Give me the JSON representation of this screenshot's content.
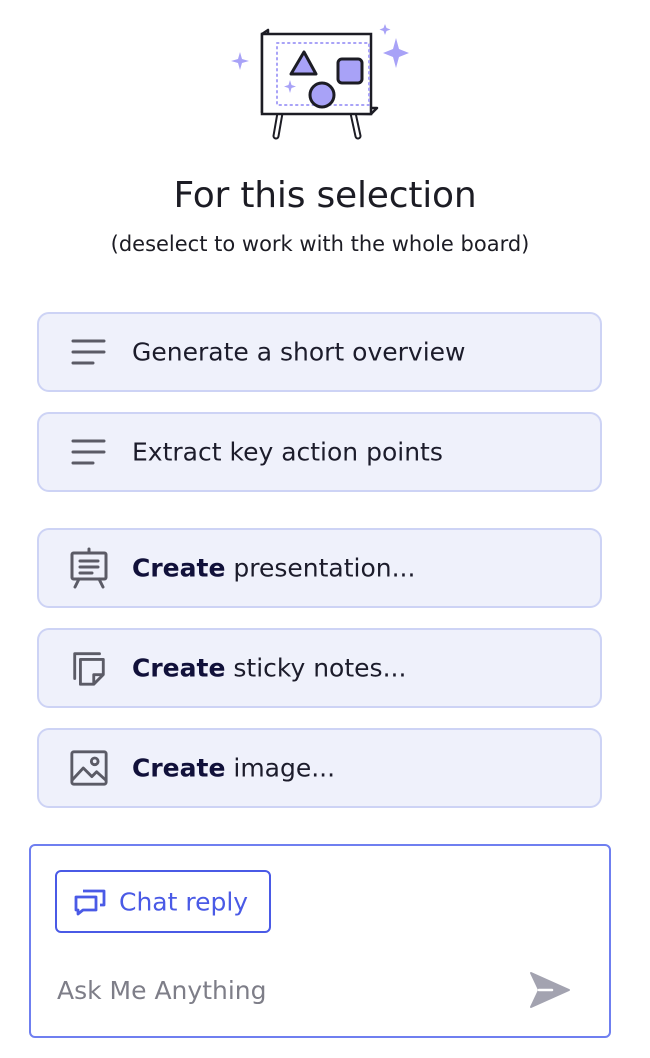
{
  "header": {
    "title": "For this selection",
    "subtitle": "(deselect to work with the whole board)"
  },
  "actions": [
    {
      "icon": "text-lines-icon",
      "bold": "",
      "label": "Generate a short overview"
    },
    {
      "icon": "text-lines-icon",
      "bold": "",
      "label": "Extract key action points"
    },
    {
      "icon": "presentation-easel-icon",
      "bold": "Create",
      "label": " presentation..."
    },
    {
      "icon": "sticky-notes-icon",
      "bold": "Create",
      "label": " sticky notes..."
    },
    {
      "icon": "image-icon",
      "bold": "Create",
      "label": " image..."
    }
  ],
  "composer": {
    "chip_label": "Chat reply",
    "chip_icon": "chat-bubbles-icon",
    "placeholder": "Ask Me Anything",
    "send_icon": "send-icon"
  },
  "colors": {
    "accent": "#4a5ae6",
    "button_bg": "#eff1fb",
    "button_border": "#cdd3f5",
    "illustration_fill": "#a8a2f7"
  }
}
